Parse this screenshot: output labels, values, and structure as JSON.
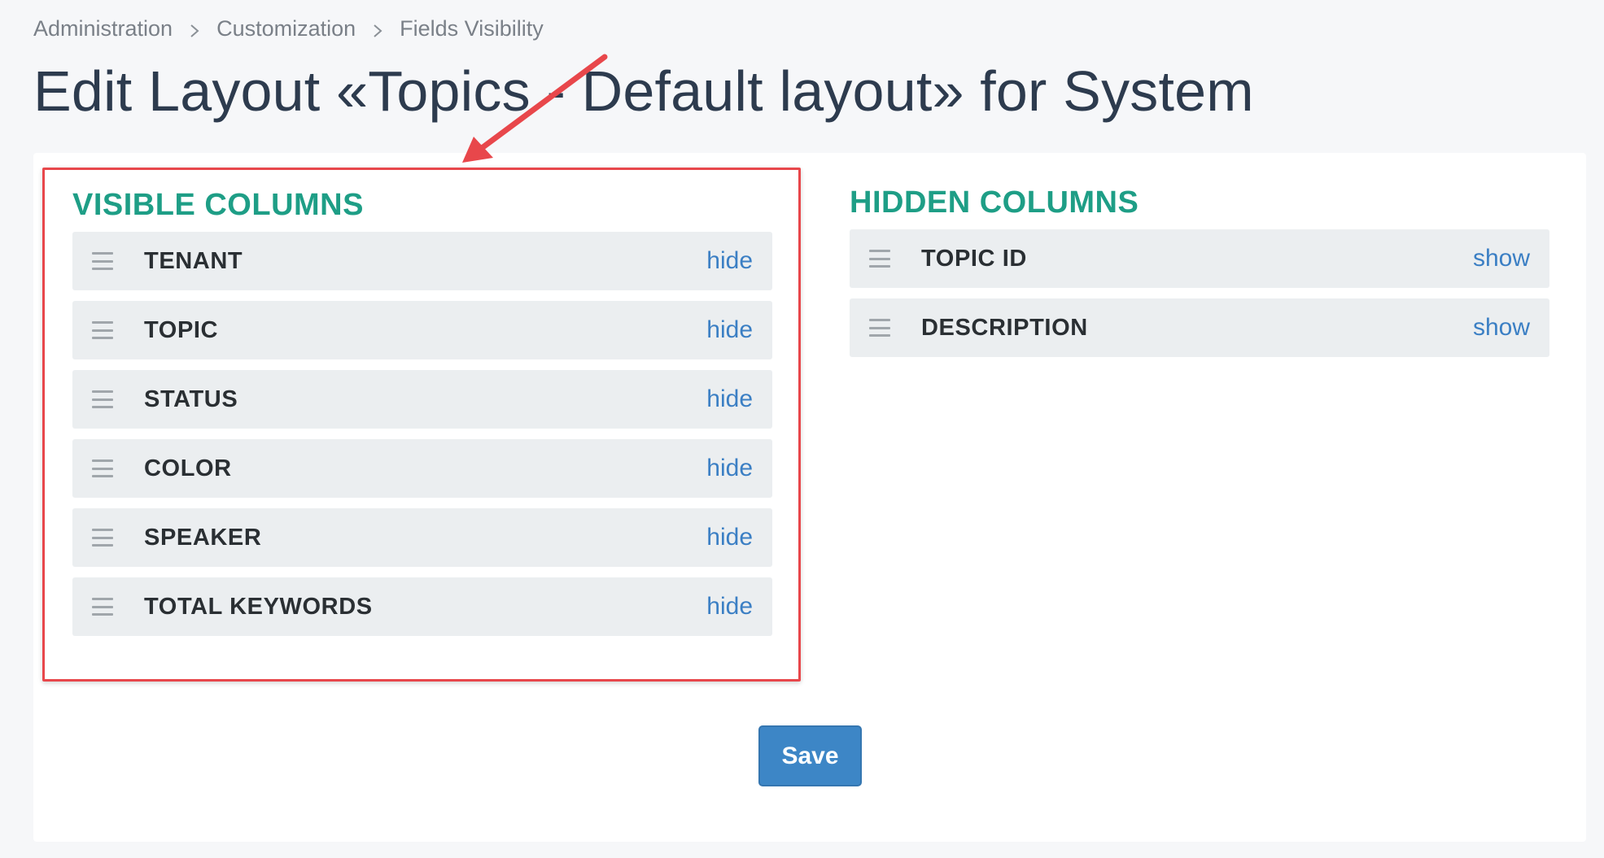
{
  "breadcrumb": {
    "items": [
      "Administration",
      "Customization",
      "Fields Visibility"
    ]
  },
  "page": {
    "title": "Edit Layout «Topics - Default layout» for System"
  },
  "visible_columns": {
    "heading": "VISIBLE COLUMNS",
    "action_label": "hide",
    "items": [
      "TENANT",
      "TOPIC",
      "STATUS",
      "COLOR",
      "SPEAKER",
      "TOTAL KEYWORDS"
    ]
  },
  "hidden_columns": {
    "heading": "HIDDEN COLUMNS",
    "action_label": "show",
    "items": [
      "TOPIC ID",
      "DESCRIPTION"
    ]
  },
  "actions": {
    "save_label": "Save"
  },
  "colors": {
    "heading": "#1e9e86",
    "link": "#3b7fc4",
    "primary_button": "#3d86c6",
    "annotation": "#e8474b"
  }
}
